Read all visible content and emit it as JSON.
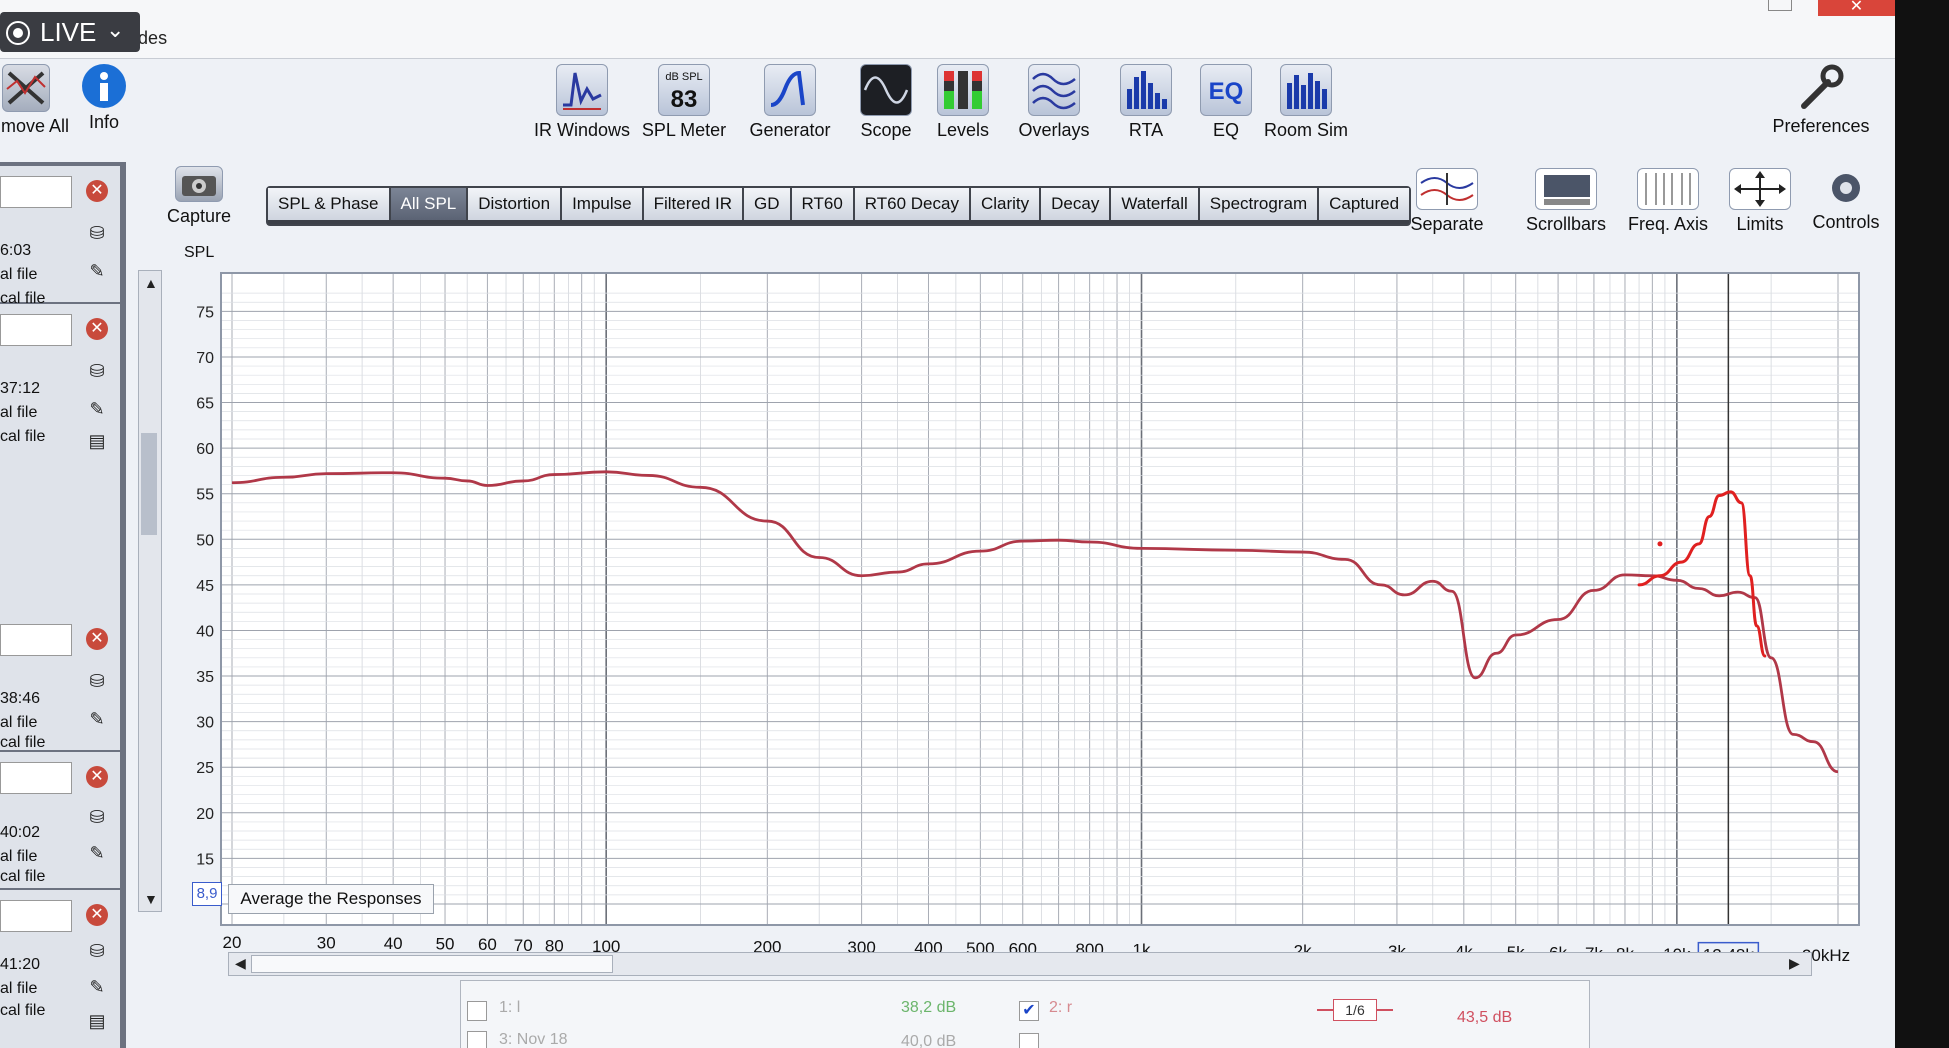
{
  "titlebar": {
    "text": "to upgrades"
  },
  "live": {
    "label": "LIVE"
  },
  "toolbar_left": [
    {
      "label": "move All",
      "icon": "remove-all-icon"
    },
    {
      "label": "Info",
      "icon": "info-icon"
    }
  ],
  "toolbar": [
    {
      "label": "IR Windows",
      "icon": "ir-windows-icon"
    },
    {
      "label": "SPL Meter",
      "icon": "spl-meter-icon",
      "badge_top": "dB SPL",
      "badge_value": "83"
    },
    {
      "label": "Generator",
      "icon": "generator-icon"
    },
    {
      "label": "Scope",
      "icon": "scope-icon"
    },
    {
      "label": "Levels",
      "icon": "levels-icon"
    },
    {
      "label": "Overlays",
      "icon": "overlays-icon"
    },
    {
      "label": "RTA",
      "icon": "rta-icon"
    },
    {
      "label": "EQ",
      "icon": "eq-icon"
    },
    {
      "label": "Room Sim",
      "icon": "room-sim-icon"
    }
  ],
  "preferences": {
    "label": "Preferences"
  },
  "capture": {
    "label": "Capture"
  },
  "tabs": [
    {
      "label": "SPL & Phase",
      "active": false
    },
    {
      "label": "All SPL",
      "active": true
    },
    {
      "label": "Distortion",
      "active": false
    },
    {
      "label": "Impulse",
      "active": false
    },
    {
      "label": "Filtered IR",
      "active": false
    },
    {
      "label": "GD",
      "active": false
    },
    {
      "label": "RT60",
      "active": false
    },
    {
      "label": "RT60 Decay",
      "active": false
    },
    {
      "label": "Clarity",
      "active": false
    },
    {
      "label": "Decay",
      "active": false
    },
    {
      "label": "Waterfall",
      "active": false
    },
    {
      "label": "Spectrogram",
      "active": false
    },
    {
      "label": "Captured",
      "active": false
    }
  ],
  "right_tools": [
    {
      "label": "Separate",
      "icon": "separate-icon"
    },
    {
      "label": "Scrollbars",
      "icon": "scrollbars-icon"
    },
    {
      "label": "Freq. Axis",
      "icon": "freq-axis-icon"
    },
    {
      "label": "Limits",
      "icon": "limits-icon"
    },
    {
      "label": "Controls",
      "icon": "controls-icon"
    }
  ],
  "measurements": [
    {
      "time": "6:03",
      "line1": "al file",
      "line2": "cal file"
    },
    {
      "time": "37:12",
      "line1": "al file",
      "line2": "cal file"
    },
    {
      "time": "38:46",
      "line1": "al file",
      "line2": "cal file"
    },
    {
      "time": "40:02",
      "line1": "al file",
      "line2": "cal file"
    },
    {
      "time": "41:20",
      "line1": "al file",
      "line2": "cal file"
    }
  ],
  "chart_data": {
    "type": "line",
    "title": "",
    "xlabel": "",
    "ylabel": "SPL",
    "x_scale": "log",
    "xlim": [
      20,
      20000
    ],
    "ylim": [
      8.9,
      78
    ],
    "y_ticks": [
      "75",
      "70",
      "65",
      "60",
      "55",
      "50",
      "45",
      "40",
      "35",
      "30",
      "25",
      "20",
      "15"
    ],
    "x_ticks": [
      "20",
      "30",
      "40",
      "50",
      "60",
      "70",
      "80",
      "100",
      "200",
      "300",
      "400",
      "500",
      "600",
      "800",
      "1k",
      "2k",
      "3k",
      "4k",
      "5k",
      "6k",
      "7k",
      "8k",
      "10k",
      "12,48k",
      "20kHz"
    ],
    "cursor_freq": "12,48k",
    "series": [
      {
        "color": "#b03848",
        "x": [
          20,
          25,
          30,
          40,
          50,
          55,
          60,
          70,
          80,
          100,
          120,
          150,
          200,
          250,
          300,
          350,
          400,
          500,
          600,
          700,
          800,
          1000,
          1500,
          2000,
          2400,
          2800,
          3100,
          3500,
          3800,
          4200,
          4600,
          5000,
          6000,
          7000,
          8000,
          9000,
          10000,
          11000,
          12000,
          13000,
          14000,
          15000,
          16500,
          18000,
          20000
        ],
        "y": [
          56.2,
          56.8,
          57.2,
          57.3,
          56.7,
          56.4,
          55.9,
          56.4,
          57.1,
          57.4,
          57.0,
          55.7,
          52.0,
          48.0,
          46.0,
          46.4,
          47.3,
          48.7,
          49.8,
          49.9,
          49.7,
          49.0,
          48.8,
          48.6,
          47.8,
          45.0,
          43.9,
          45.4,
          44.3,
          34.8,
          37.5,
          39.5,
          41.2,
          44.4,
          46.1,
          46.0,
          45.5,
          44.6,
          43.8,
          44.2,
          43.6,
          37.0,
          28.6,
          27.8,
          24.5
        ]
      }
    ],
    "annotation": {
      "color": "#e02020",
      "x": [
        8500,
        9300,
        10200,
        11000,
        11500,
        12000,
        12600,
        13200,
        13700,
        14100,
        14600
      ],
      "y": [
        45.0,
        46.0,
        47.5,
        49.5,
        52.5,
        54.8,
        55.2,
        54.0,
        46.0,
        40.5,
        37.2
      ]
    }
  },
  "avg_button": {
    "label": "Average the Responses"
  },
  "smoothing_value": "8,9",
  "bottom_panel": {
    "row1_name": "1: l",
    "row1_value": "38,2 dB",
    "row2_name": "2: r",
    "row2_smoothing": "1/6",
    "row2_value": "43,5 dB",
    "row3_name": "3: Nov 18",
    "row3_value": "40,0 dB"
  }
}
